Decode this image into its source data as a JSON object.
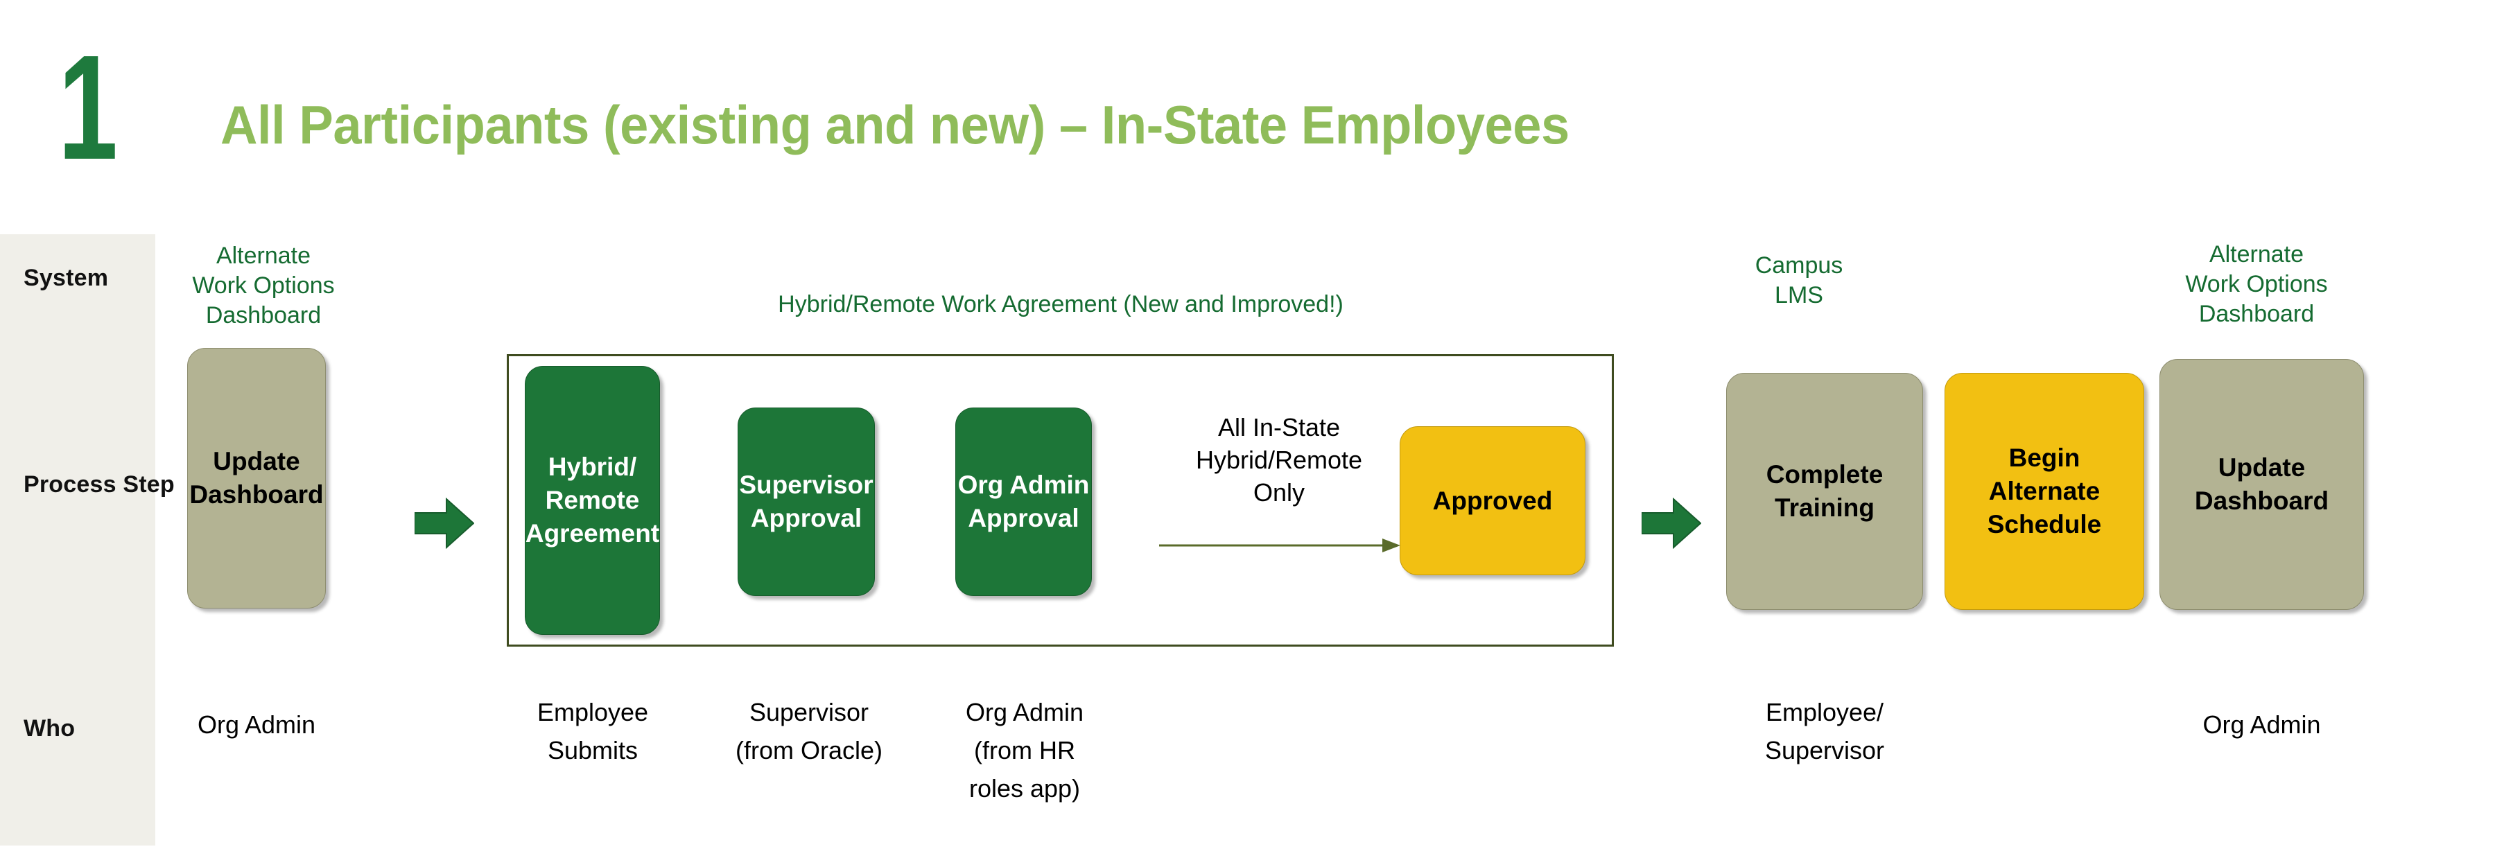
{
  "header": {
    "step_number": "1",
    "title": "All Participants (existing and new) – In-State Employees",
    "number_color": "#1e7a3d",
    "title_color": "#8fbc5a"
  },
  "rail": {
    "rows": [
      {
        "label": "System"
      },
      {
        "label": "Process\nStep"
      },
      {
        "label": "Who"
      }
    ],
    "background_color": "#f0efe9"
  },
  "group": {
    "caption": "Hybrid/Remote Work Agreement (New and Improved!)",
    "border_color": "#3f4c20"
  },
  "systems": [
    {
      "name": "alternate-work-options-dashboard-left",
      "caption": "Alternate\nWork Options\nDashboard"
    },
    {
      "name": "campus-lms",
      "caption": "Campus\nLMS"
    },
    {
      "name": "alternate-work-options-dashboard-right",
      "caption": "Alternate\nWork Options\nDashboard"
    }
  ],
  "steps": [
    {
      "name": "update-dashboard-start",
      "label": "Update\nDashboard",
      "style": "khaki",
      "color": "#b3b393"
    },
    {
      "name": "hybrid-remote-agreement",
      "label": "Hybrid/\nRemote\nAgreement",
      "style": "green",
      "color": "#1d7638"
    },
    {
      "name": "supervisor-approval",
      "label": "Supervisor\nApproval",
      "style": "green",
      "color": "#1d7638"
    },
    {
      "name": "org-admin-approval",
      "label": "Org Admin\nApproval",
      "style": "green",
      "color": "#1d7638"
    },
    {
      "name": "approved",
      "label": "Approved",
      "style": "gold",
      "color": "#f2c012"
    },
    {
      "name": "complete-training",
      "label": "Complete\nTraining",
      "style": "khaki",
      "color": "#b3b393"
    },
    {
      "name": "begin-alternate-schedule",
      "label": "Begin\nAlternate\nSchedule",
      "style": "gold",
      "color": "#f2c012"
    },
    {
      "name": "update-dashboard-end",
      "label": "Update\nDashboard",
      "style": "khaki",
      "color": "#b3b393"
    }
  ],
  "condition": {
    "label": "All In-State\nHybrid/Remote\nOnly"
  },
  "who": [
    {
      "name": "who-org-admin-start",
      "label": "Org Admin"
    },
    {
      "name": "who-employee-submits",
      "label": "Employee\nSubmits"
    },
    {
      "name": "who-supervisor-oracle",
      "label": "Supervisor\n(from Oracle)"
    },
    {
      "name": "who-org-admin-hr-roles",
      "label": "Org Admin\n(from HR\nroles app)"
    },
    {
      "name": "who-employee-supervisor",
      "label": "Employee/\nSupervisor"
    },
    {
      "name": "who-org-admin-end",
      "label": "Org Admin"
    }
  ],
  "arrows": {
    "block_color": "#1d7638",
    "thin_color": "#5a6b2a"
  }
}
